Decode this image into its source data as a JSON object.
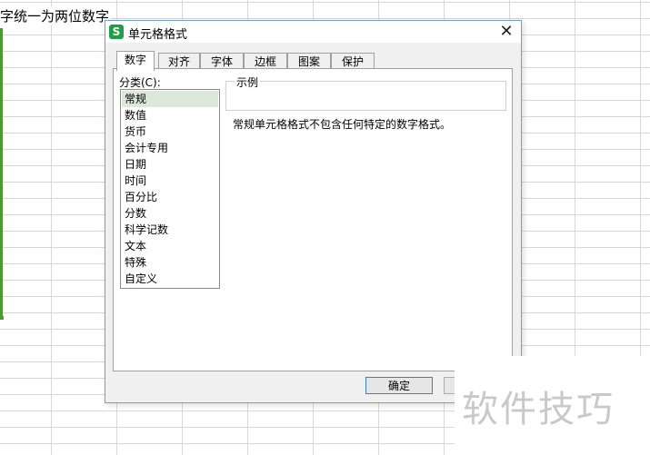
{
  "sheet": {
    "cell_text": "字统一为两位数字"
  },
  "dialog": {
    "app_icon_glyph": "S",
    "title": "单元格格式",
    "close_glyph": "✕",
    "tabs": [
      {
        "label": "数字",
        "active": true
      },
      {
        "label": "对齐",
        "active": false
      },
      {
        "label": "字体",
        "active": false
      },
      {
        "label": "边框",
        "active": false
      },
      {
        "label": "图案",
        "active": false
      },
      {
        "label": "保护",
        "active": false
      }
    ],
    "category_label": "分类(C):",
    "categories": [
      "常规",
      "数值",
      "货币",
      "会计专用",
      "日期",
      "时间",
      "百分比",
      "分数",
      "科学记数",
      "文本",
      "特殊",
      "自定义"
    ],
    "selected_category": "常规",
    "sample_label": "示例",
    "description": "常规单元格格式不包含任何特定的数字格式。",
    "ok_label": "确定"
  },
  "watermark": "软件技巧",
  "colors": {
    "accent_green": "#4a9a2e",
    "dialog_border": "#6fa0d8",
    "selected_item": "#dde8d8"
  }
}
